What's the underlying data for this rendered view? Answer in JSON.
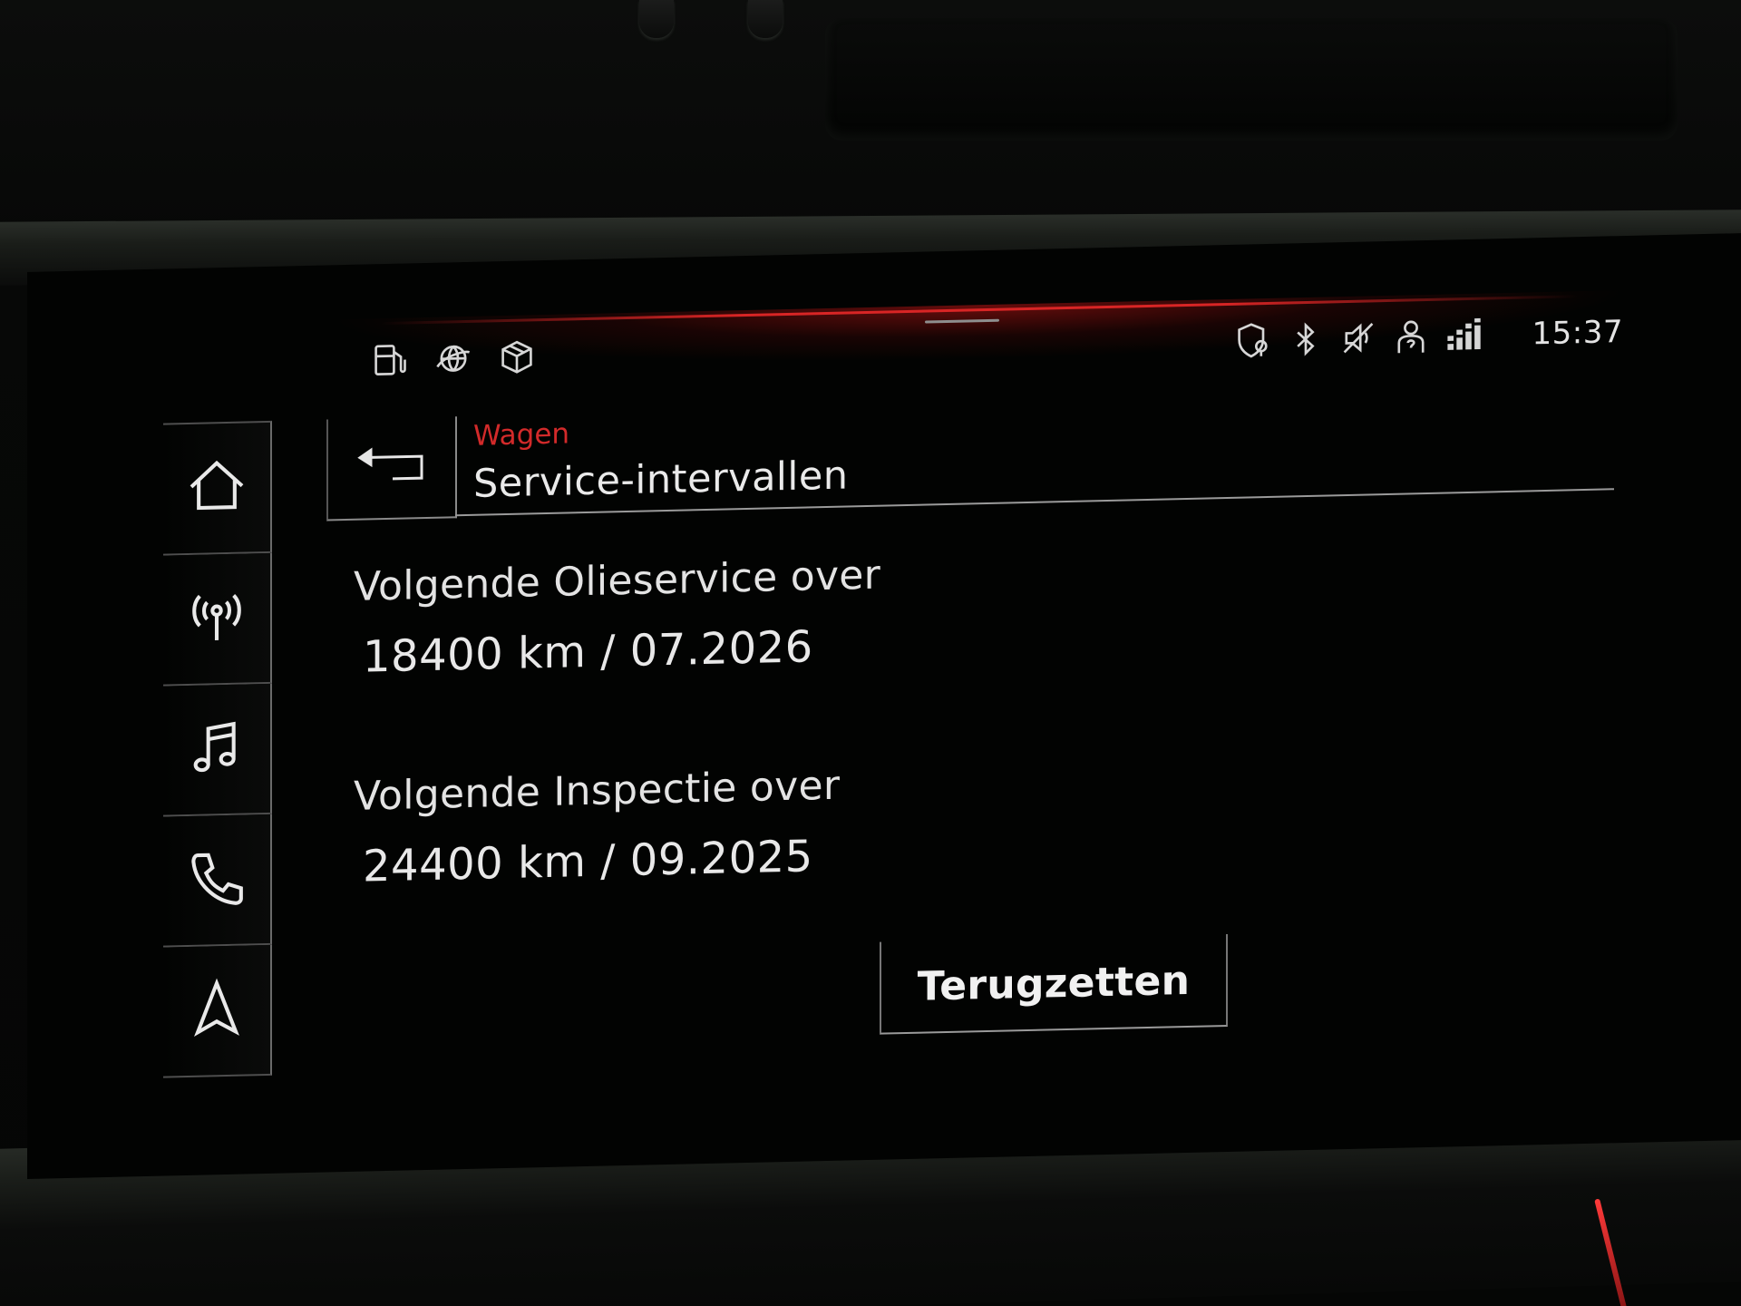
{
  "status_bar": {
    "left_icons": [
      "fuel-icon",
      "connectivity-icon",
      "package-icon"
    ],
    "right_icons": [
      "shield-location-icon",
      "bluetooth-icon",
      "muted-speaker-icon",
      "person-help-icon",
      "signal-bars-icon"
    ],
    "time": "15:37",
    "accent_color": "#d82525"
  },
  "sidebar": {
    "items": [
      {
        "id": "home",
        "icon": "home-icon"
      },
      {
        "id": "radio",
        "icon": "radio-antenna-icon"
      },
      {
        "id": "media",
        "icon": "music-note-icon"
      },
      {
        "id": "phone",
        "icon": "phone-icon"
      },
      {
        "id": "navigation",
        "icon": "navigation-arrow-icon"
      }
    ]
  },
  "header": {
    "breadcrumb": "Wagen",
    "title": "Service-intervallen",
    "back_icon": "back-arrow-icon"
  },
  "service": {
    "oil": {
      "label": "Volgende Olieservice over",
      "value": "18400 km / 07.2026"
    },
    "inspection": {
      "label": "Volgende Inspectie over",
      "value": "24400 km / 09.2025"
    }
  },
  "actions": {
    "reset_label": "Terugzetten"
  },
  "colors": {
    "background": "#020302",
    "text": "#e6e6e6",
    "breadcrumb": "#d22a2a"
  }
}
